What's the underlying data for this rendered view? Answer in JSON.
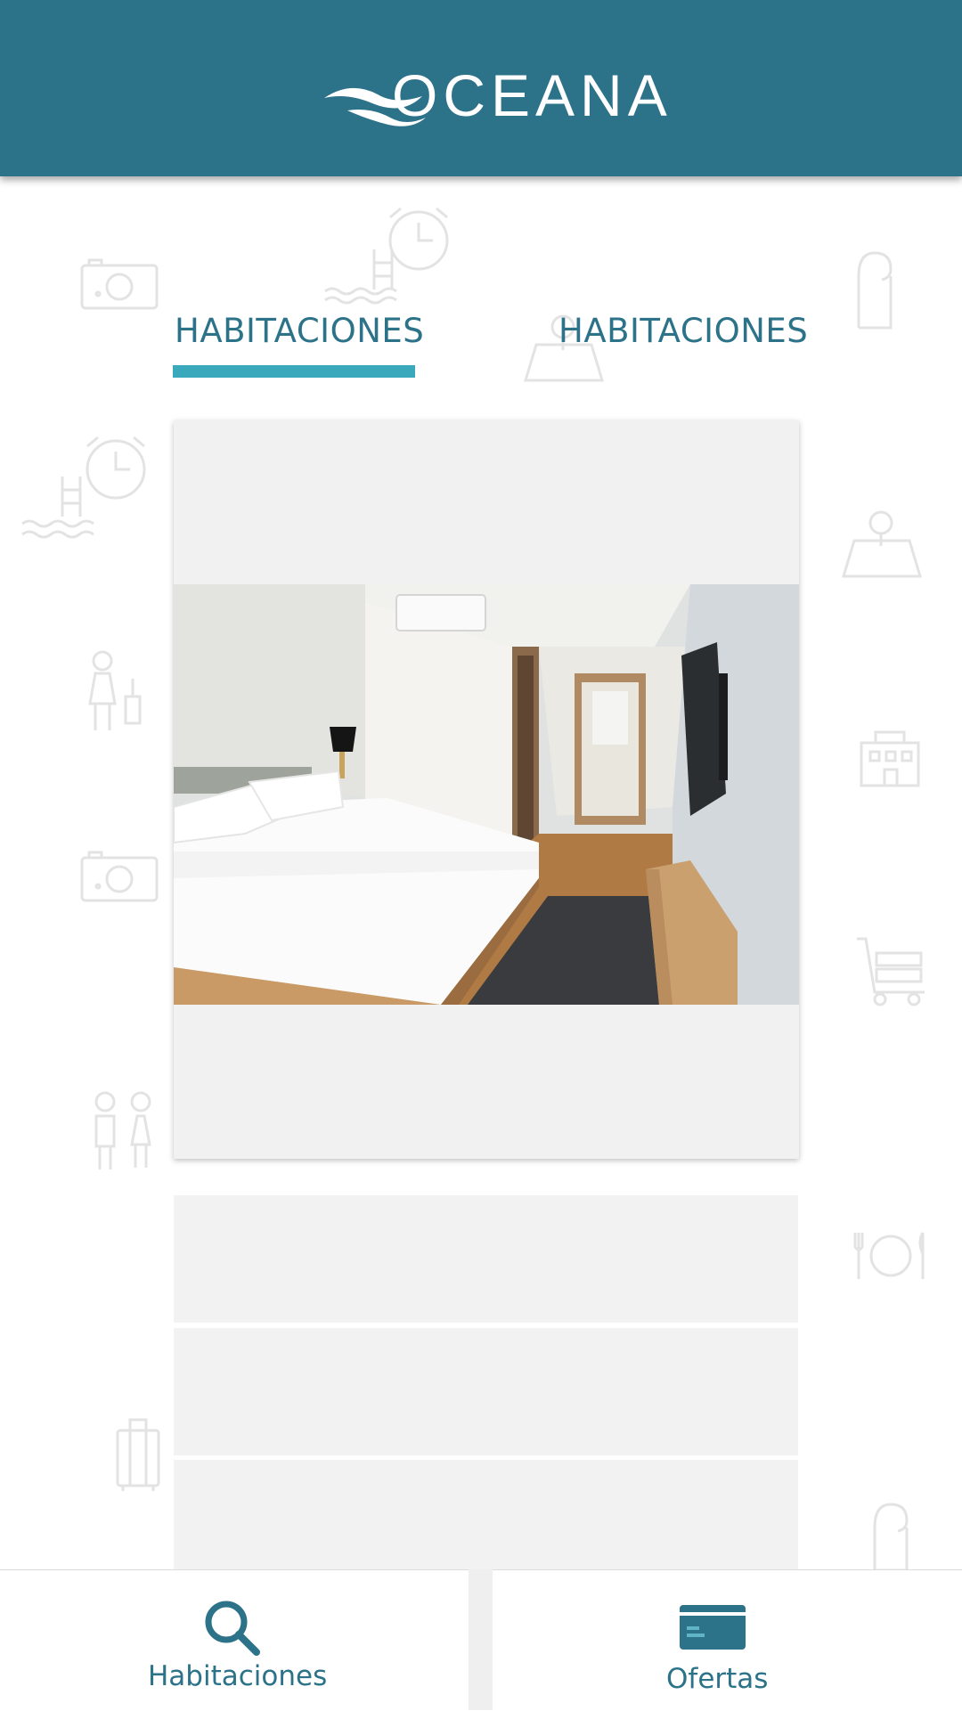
{
  "app": {
    "brand": "OCEANA"
  },
  "colors": {
    "primary": "#2c7289",
    "accent": "#39a9bb",
    "card_bg": "#f1f1f1"
  },
  "tabs": [
    {
      "label": "HABITACIONES",
      "selected": true
    },
    {
      "label": "HABITACIONES",
      "selected": false
    }
  ],
  "card": {
    "image": "hotel-room-photo"
  },
  "bottom_nav": {
    "items": [
      {
        "label": "Habitaciones",
        "icon": "search-icon"
      },
      {
        "label": "Ofertas",
        "icon": "credit-card-icon"
      }
    ]
  },
  "background_icons": [
    "camera-icon",
    "pool-icon",
    "alarm-clock-icon",
    "door-hanger-icon",
    "map-icon",
    "people-icon",
    "building-icon",
    "luggage-cart-icon",
    "dining-icon",
    "suitcase-icon"
  ]
}
